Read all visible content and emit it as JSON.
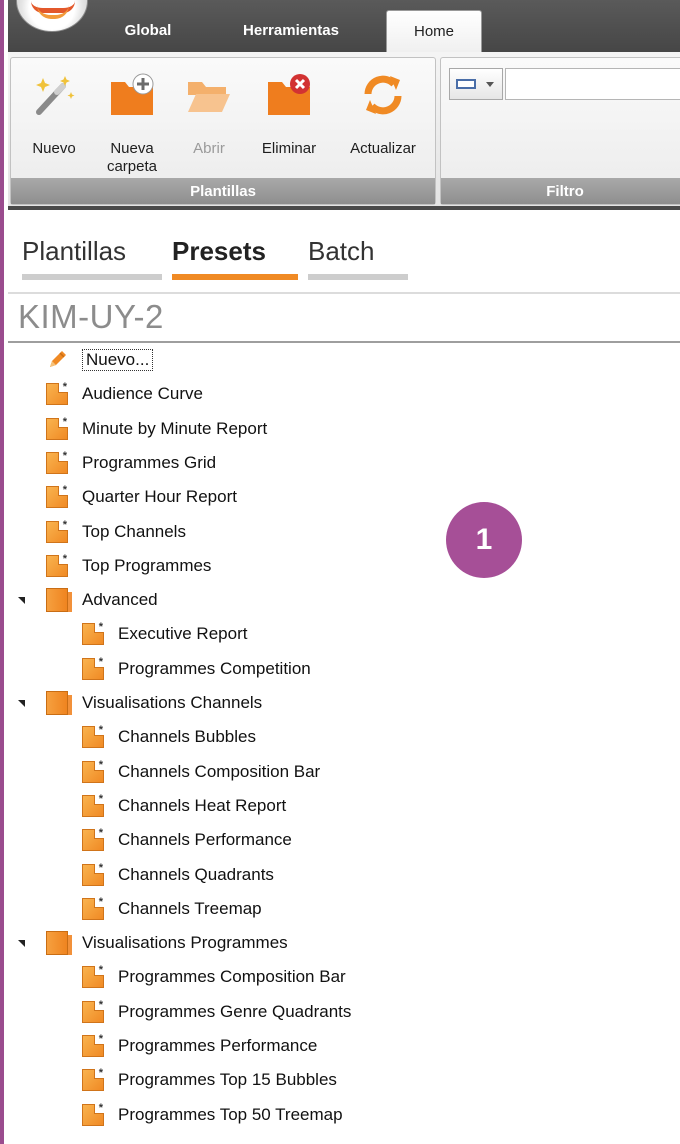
{
  "ribbon": {
    "tabs": [
      {
        "label": "Global",
        "active": false
      },
      {
        "label": "Herramientas",
        "active": false
      },
      {
        "label": "Home",
        "active": true
      }
    ],
    "groups": {
      "plantillas": {
        "label": "Plantillas",
        "buttons": [
          {
            "label": "Nuevo",
            "icon": "magic-wand-icon",
            "enabled": true
          },
          {
            "label": "Nueva\ncarpeta",
            "icon": "new-folder-icon",
            "enabled": true
          },
          {
            "label": "Abrir",
            "icon": "open-folder-icon",
            "enabled": false
          },
          {
            "label": "Eliminar",
            "icon": "delete-folder-icon",
            "enabled": true
          },
          {
            "label": "Actualizar",
            "icon": "refresh-icon",
            "enabled": true
          }
        ]
      },
      "filtro": {
        "label": "Filtro",
        "input_value": ""
      }
    }
  },
  "subtabs": [
    {
      "label": "Plantillas",
      "active": false
    },
    {
      "label": "Presets",
      "active": true
    },
    {
      "label": "Batch",
      "active": false
    }
  ],
  "node_title": "KIM-UY-2",
  "tree": [
    {
      "label": "Nuevo...",
      "type": "new",
      "level": 0
    },
    {
      "label": "Audience Curve",
      "type": "doc",
      "level": 0
    },
    {
      "label": "Minute by Minute Report",
      "type": "doc",
      "level": 0
    },
    {
      "label": "Programmes Grid",
      "type": "doc",
      "level": 0
    },
    {
      "label": "Quarter Hour Report",
      "type": "doc",
      "level": 0
    },
    {
      "label": "Top Channels",
      "type": "doc",
      "level": 0
    },
    {
      "label": "Top Programmes",
      "type": "doc",
      "level": 0
    },
    {
      "label": "Advanced",
      "type": "folder",
      "level": 0
    },
    {
      "label": "Executive Report",
      "type": "doc",
      "level": 1
    },
    {
      "label": "Programmes Competition",
      "type": "doc",
      "level": 1
    },
    {
      "label": "Visualisations Channels",
      "type": "folder",
      "level": 0
    },
    {
      "label": "Channels Bubbles",
      "type": "doc",
      "level": 1
    },
    {
      "label": "Channels Composition Bar",
      "type": "doc",
      "level": 1
    },
    {
      "label": "Channels Heat Report",
      "type": "doc",
      "level": 1
    },
    {
      "label": "Channels Performance",
      "type": "doc",
      "level": 1
    },
    {
      "label": "Channels Quadrants",
      "type": "doc",
      "level": 1
    },
    {
      "label": "Channels Treemap",
      "type": "doc",
      "level": 1
    },
    {
      "label": "Visualisations Programmes",
      "type": "folder",
      "level": 0
    },
    {
      "label": "Programmes Composition Bar",
      "type": "doc",
      "level": 1
    },
    {
      "label": "Programmes Genre Quadrants",
      "type": "doc",
      "level": 1
    },
    {
      "label": "Programmes Performance",
      "type": "doc",
      "level": 1
    },
    {
      "label": "Programmes Top 15  Bubbles",
      "type": "doc",
      "level": 1
    },
    {
      "label": "Programmes Top 50 Treemap",
      "type": "doc",
      "level": 1
    }
  ],
  "badge": {
    "label": "1",
    "color": "#a64f97"
  },
  "colors": {
    "accent": "#f08a24",
    "frame": "#9a4c8e",
    "ribbon_dark": "#4a4a4a"
  }
}
